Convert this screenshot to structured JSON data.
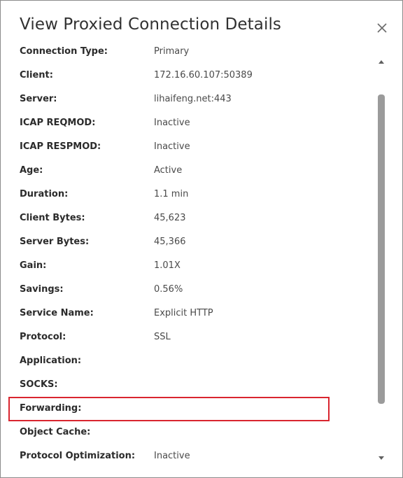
{
  "dialog": {
    "title": "View Proxied Connection Details",
    "close_icon": "close-icon"
  },
  "details": [
    {
      "label": "Connection Type:",
      "value": "Primary"
    },
    {
      "label": "Client:",
      "value": "172.16.60.107:50389"
    },
    {
      "label": "Server:",
      "value": "lihaifeng.net:443"
    },
    {
      "label": "ICAP REQMOD:",
      "value": "Inactive"
    },
    {
      "label": "ICAP RESPMOD:",
      "value": "Inactive"
    },
    {
      "label": "Age:",
      "value": "Active"
    },
    {
      "label": "Duration:",
      "value": "1.1 min"
    },
    {
      "label": "Client Bytes:",
      "value": "45,623"
    },
    {
      "label": "Server Bytes:",
      "value": "45,366"
    },
    {
      "label": "Gain:",
      "value": "1.01X"
    },
    {
      "label": "Savings:",
      "value": "0.56%"
    },
    {
      "label": "Service Name:",
      "value": "Explicit HTTP"
    },
    {
      "label": "Protocol:",
      "value": "SSL"
    },
    {
      "label": "Application:",
      "value": ""
    },
    {
      "label": "SOCKS:",
      "value": ""
    },
    {
      "label": "Forwarding:",
      "value": ""
    },
    {
      "label": "Object Cache:",
      "value": ""
    },
    {
      "label": "Protocol Optimization:",
      "value": "Inactive"
    }
  ],
  "highlight": {
    "row_label": "Forwarding:",
    "color": "#d9252f"
  },
  "scrollbar": {
    "up_icon": "scroll-up-arrow-icon",
    "down_icon": "scroll-down-arrow-icon"
  }
}
